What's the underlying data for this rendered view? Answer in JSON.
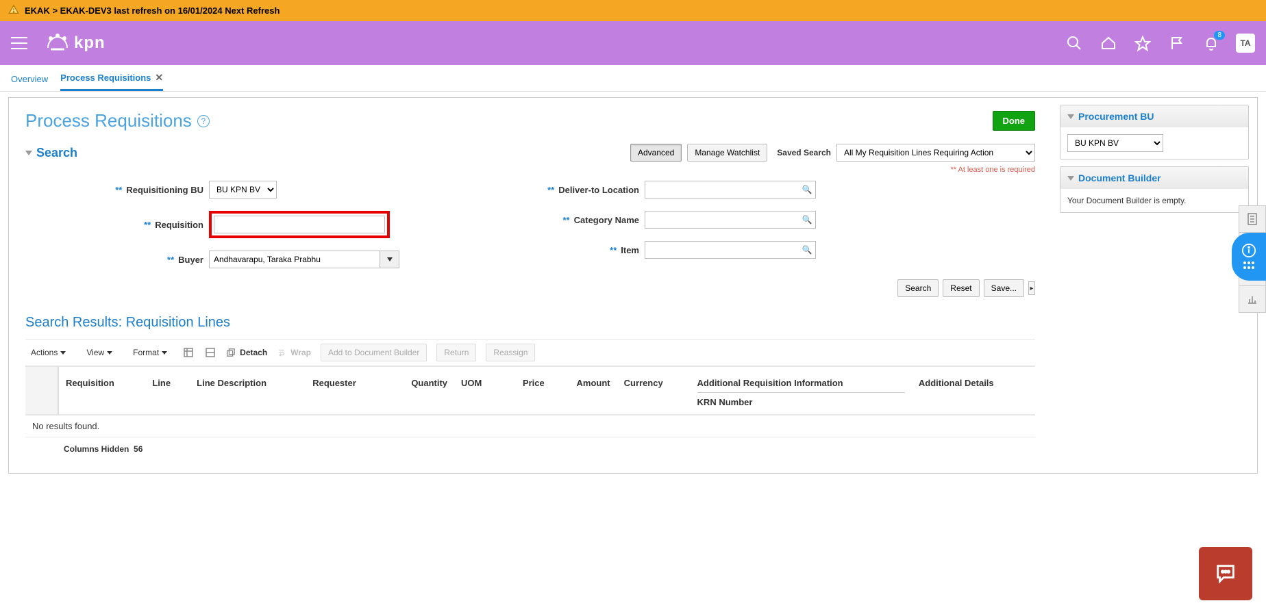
{
  "notification_bar": {
    "text": "EKAK > EKAK-DEV3 last refresh on 16/01/2024 Next Refresh"
  },
  "header": {
    "logo_text": "kpn",
    "bell_badge": "8",
    "avatar_initials": "TA"
  },
  "tabs": [
    {
      "label": "Overview",
      "active": false,
      "closable": false
    },
    {
      "label": "Process Requisitions",
      "active": true,
      "closable": true
    }
  ],
  "page": {
    "title": "Process Requisitions",
    "done_label": "Done"
  },
  "search": {
    "title": "Search",
    "advanced_label": "Advanced",
    "manage_watchlist_label": "Manage Watchlist",
    "saved_search_label": "Saved Search",
    "saved_search_value": "All My Requisition Lines Requiring Action",
    "hint_required": "** At least one is required",
    "fields": {
      "requisitioning_bu": {
        "label": "Requisitioning BU",
        "value": "BU KPN BV"
      },
      "requisition": {
        "label": "Requisition",
        "value": ""
      },
      "buyer": {
        "label": "Buyer",
        "value": "Andhavarapu, Taraka Prabhu"
      },
      "deliver_to": {
        "label": "Deliver-to Location",
        "value": ""
      },
      "category": {
        "label": "Category Name",
        "value": ""
      },
      "item": {
        "label": "Item",
        "value": ""
      }
    },
    "buttons": {
      "search": "Search",
      "reset": "Reset",
      "save": "Save..."
    }
  },
  "results": {
    "title": "Search Results: Requisition Lines",
    "toolbar": {
      "actions": "Actions",
      "view": "View",
      "format": "Format",
      "detach": "Detach",
      "wrap": "Wrap",
      "add_builder": "Add to Document Builder",
      "return": "Return",
      "reassign": "Reassign"
    },
    "columns": [
      "Requisition",
      "Line",
      "Line Description",
      "Requester",
      "Quantity",
      "UOM",
      "Price",
      "Amount",
      "Currency"
    ],
    "additional_group": {
      "top": "Additional Requisition Information",
      "sub": "KRN Number"
    },
    "additional_details": "Additional Details",
    "no_results": "No results found.",
    "columns_hidden_label": "Columns Hidden",
    "columns_hidden_count": "56"
  },
  "sidebar": {
    "procurement_bu": {
      "title": "Procurement BU",
      "value": "BU KPN BV"
    },
    "doc_builder": {
      "title": "Document Builder",
      "empty_text": "Your Document Builder is empty."
    }
  }
}
